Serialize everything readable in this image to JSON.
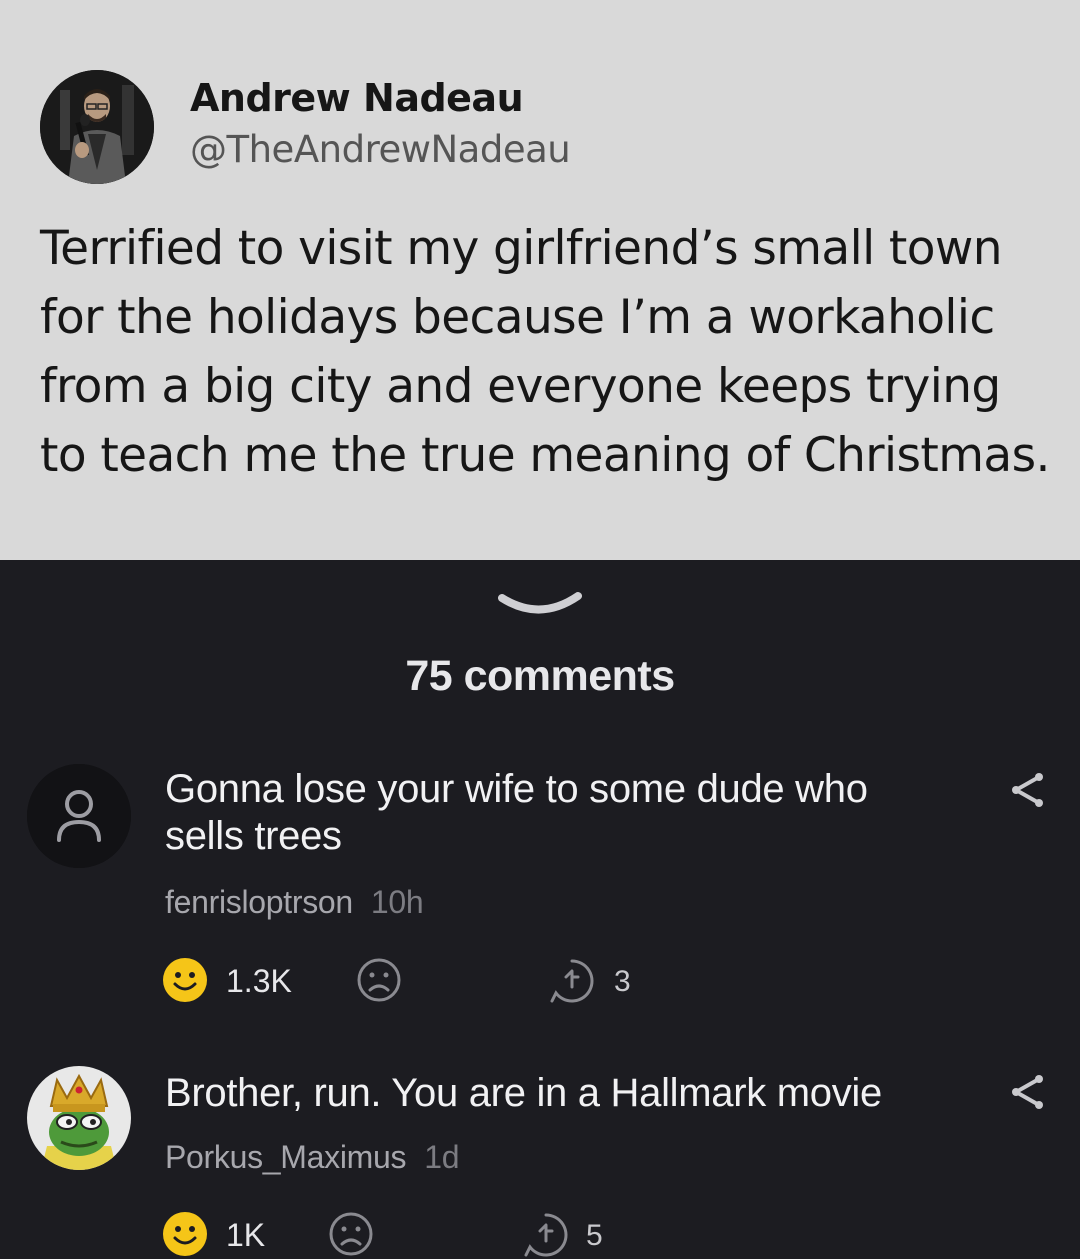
{
  "tweet": {
    "author_name": "Andrew Nadeau",
    "author_handle": "@TheAndrewNadeau",
    "text": "Terrified to visit my girlfriend’s small town for the holidays because I’m a workaholic from a big city and everyone keeps trying to teach me the true meaning of Christmas."
  },
  "comments_header": "75 comments",
  "comments": [
    {
      "text": "Gonna lose your wife to some dude who sells trees",
      "username": "fenrisloptrson",
      "time": "10h",
      "likes": "1.3K",
      "replies": "3"
    },
    {
      "text": "Brother, run. You are in a Hallmark movie",
      "username": "Porkus_Maximus",
      "time": "1d",
      "likes": "1K",
      "replies": "5"
    }
  ],
  "colors": {
    "tweet_bg": "#d9d9d9",
    "app_bg": "#1c1c21",
    "like_yellow": "#f5c518",
    "text_primary": "#f1f1f3",
    "text_secondary": "#a7a7ad"
  }
}
